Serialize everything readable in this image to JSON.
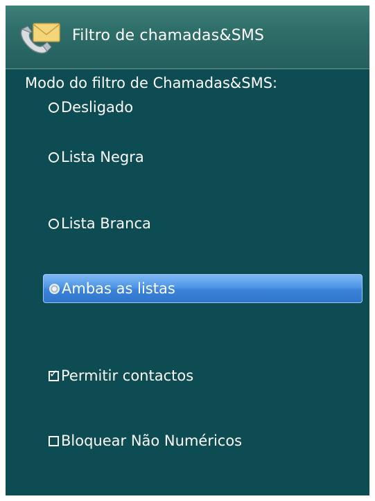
{
  "header": {
    "title": "Filtro de chamadas&SMS",
    "icon": "phone-envelope-icon"
  },
  "filter_mode": {
    "label": "Modo do filtro de Chamadas&SMS:",
    "options": [
      {
        "label": "Desligado",
        "selected": false
      },
      {
        "label": "Lista Negra",
        "selected": false
      },
      {
        "label": "Lista Branca",
        "selected": false
      },
      {
        "label": "Ambas as listas",
        "selected": true
      }
    ]
  },
  "settings": {
    "allow_contacts": {
      "label": "Permitir contactos",
      "checked": true
    },
    "block_non_numeric": {
      "label": "Bloquear Não Numéricos",
      "checked": false
    }
  },
  "colors": {
    "background": "#0e4c54",
    "header": "#2e6e69",
    "selection": "#4e95e6",
    "text": "#ffffff"
  }
}
